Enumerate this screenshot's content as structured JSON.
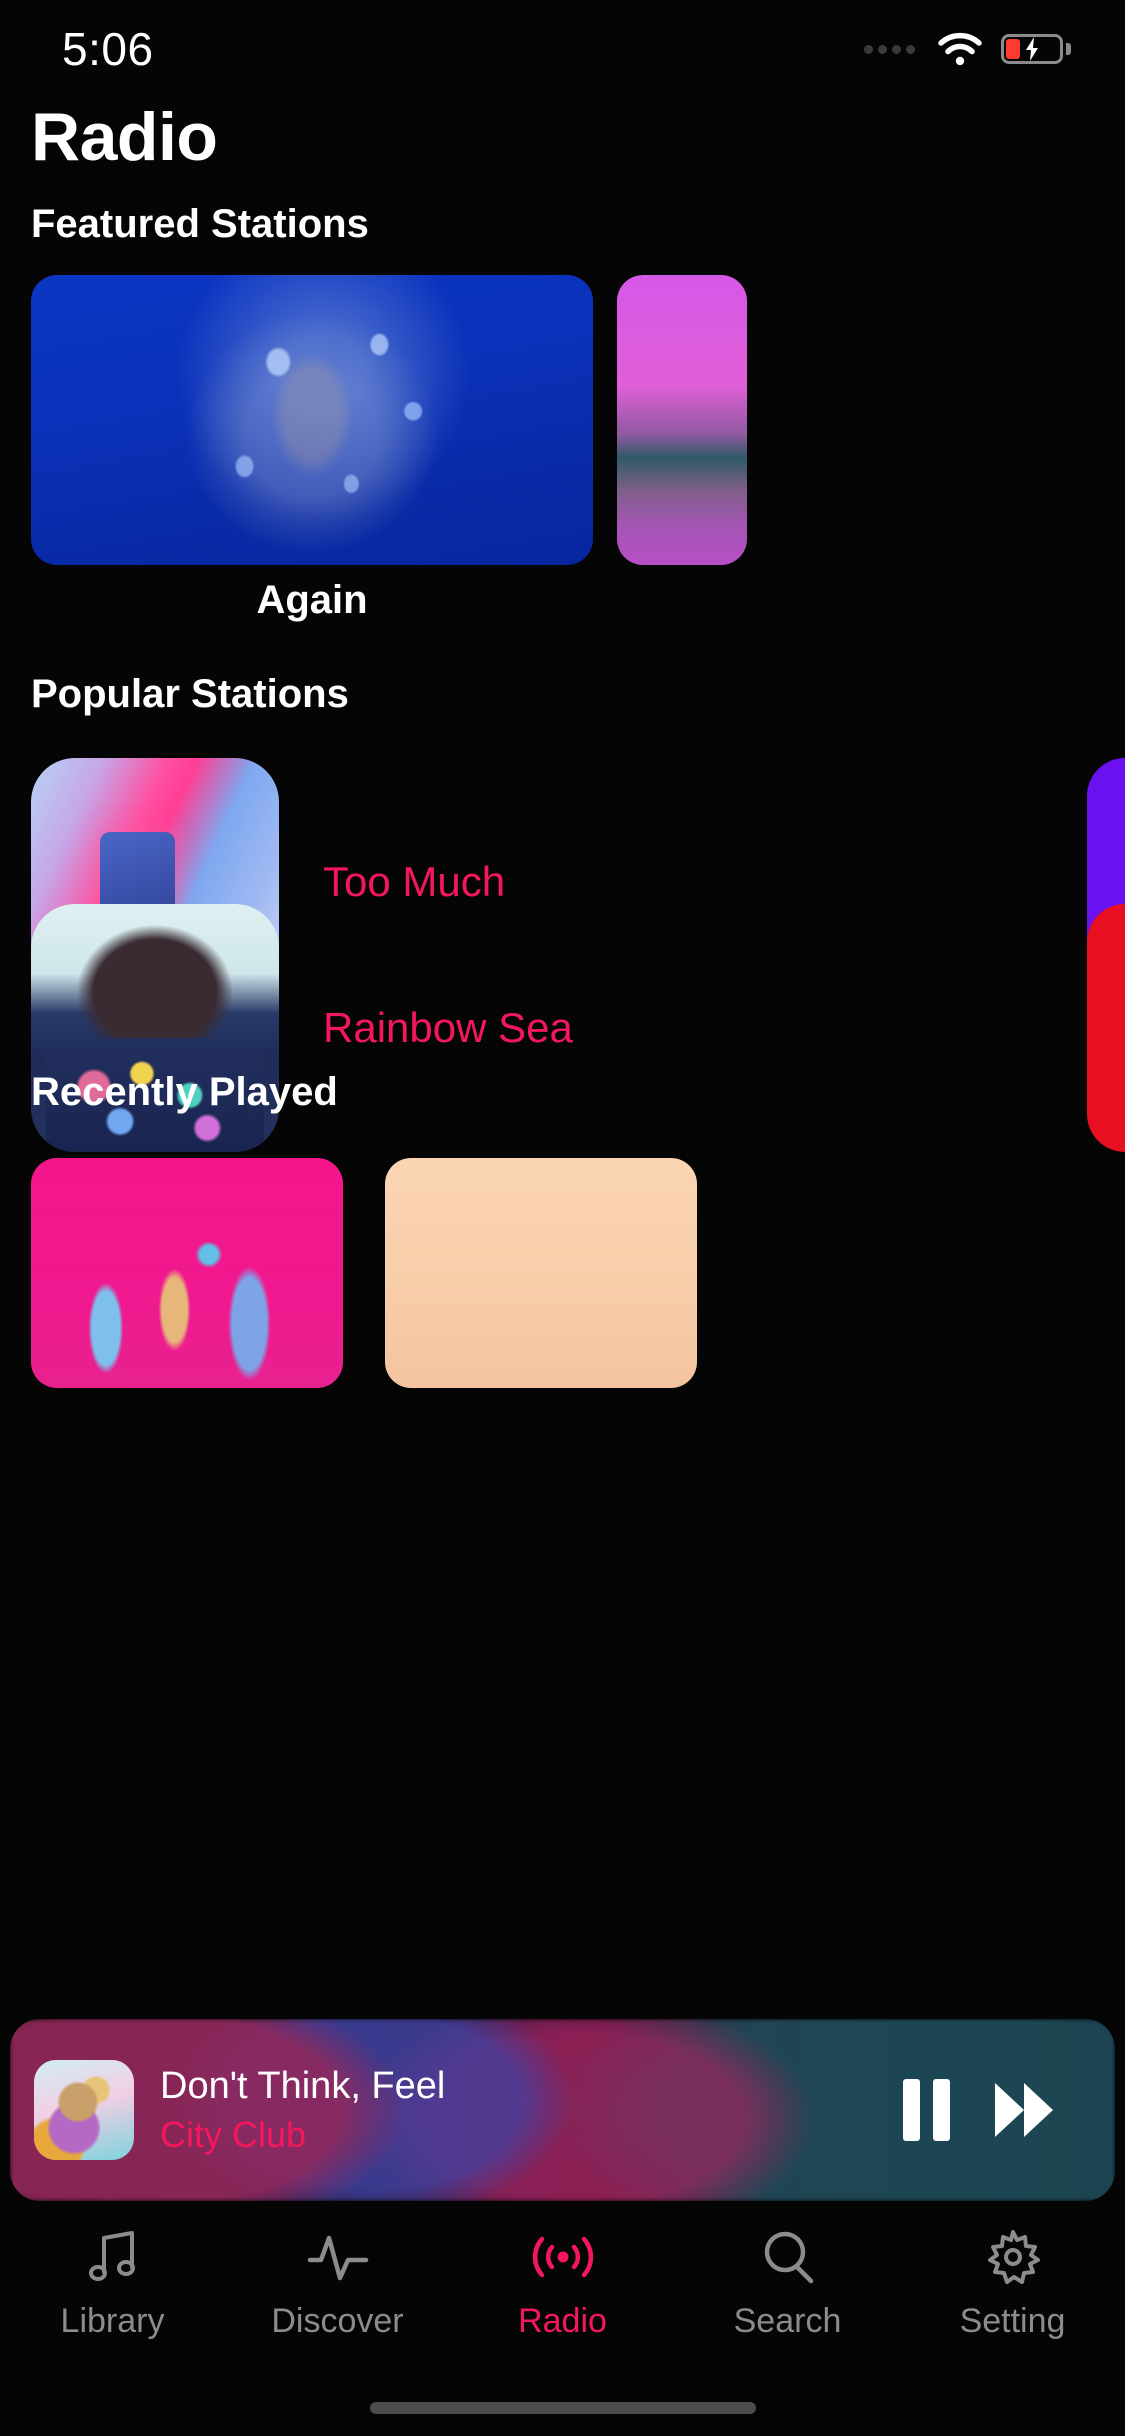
{
  "status_bar": {
    "time": "5:06",
    "wifi_icon": "wifi-icon",
    "battery_icon": "battery-charging-icon",
    "signal_icon": "signal-dots-icon"
  },
  "header": {
    "title": "Radio"
  },
  "sections": {
    "featured": {
      "heading": "Featured Stations",
      "cards": [
        {
          "title": "Again",
          "artwork": "blue-portrait-artwork"
        },
        {
          "title": "",
          "artwork": "sunset-landscape-artwork"
        }
      ]
    },
    "popular": {
      "heading": "Popular Stations",
      "rows": [
        {
          "title": "Too Much",
          "artwork": "neon-phone-artwork",
          "peek_color": "#6a11f0"
        },
        {
          "title": "Rainbow Sea",
          "artwork": "floral-portrait-artwork",
          "peek_color": "#e81020"
        }
      ]
    },
    "recent": {
      "heading": "Recently Played",
      "cards": [
        {
          "artwork": "liquid-metal-pink-artwork"
        },
        {
          "artwork": "peach-gradient-artwork"
        }
      ]
    }
  },
  "mini_player": {
    "track_title": "Don't Think, Feel",
    "artist": "City Club",
    "artwork": "abstract-object-artwork",
    "pause_label": "Pause",
    "next_label": "Next"
  },
  "tab_bar": {
    "active": "Radio",
    "items": [
      {
        "label": "Library",
        "icon": "music-note-icon"
      },
      {
        "label": "Discover",
        "icon": "pulse-wave-icon"
      },
      {
        "label": "Radio",
        "icon": "broadcast-icon"
      },
      {
        "label": "Search",
        "icon": "search-icon"
      },
      {
        "label": "Setting",
        "icon": "gear-icon"
      }
    ]
  },
  "colors": {
    "accent": "#f4175c",
    "background": "#050505",
    "text_primary": "#ffffff",
    "text_muted": "#8c8c8c"
  }
}
